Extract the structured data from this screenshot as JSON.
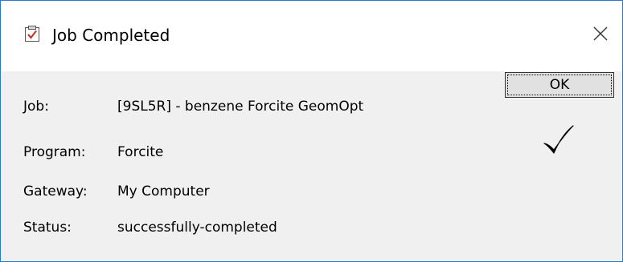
{
  "window": {
    "title": "Job Completed",
    "title_icon": "clipboard-check-icon",
    "close_icon": "close-icon"
  },
  "details": {
    "job_label": "Job:",
    "job_value": "[9SL5R] - benzene Forcite GeomOpt",
    "program_label": "Program:",
    "program_value": "Forcite",
    "gateway_label": "Gateway:",
    "gateway_value": "My Computer",
    "status_label": "Status:",
    "status_value": "successfully-completed"
  },
  "buttons": {
    "ok_label": "OK"
  },
  "status_icon": "checkmark-icon",
  "colors": {
    "window_border": "#2b78c8",
    "title_bg": "#ffffff",
    "body_bg": "#f0f0f0",
    "icon_red": "#c0392b"
  }
}
